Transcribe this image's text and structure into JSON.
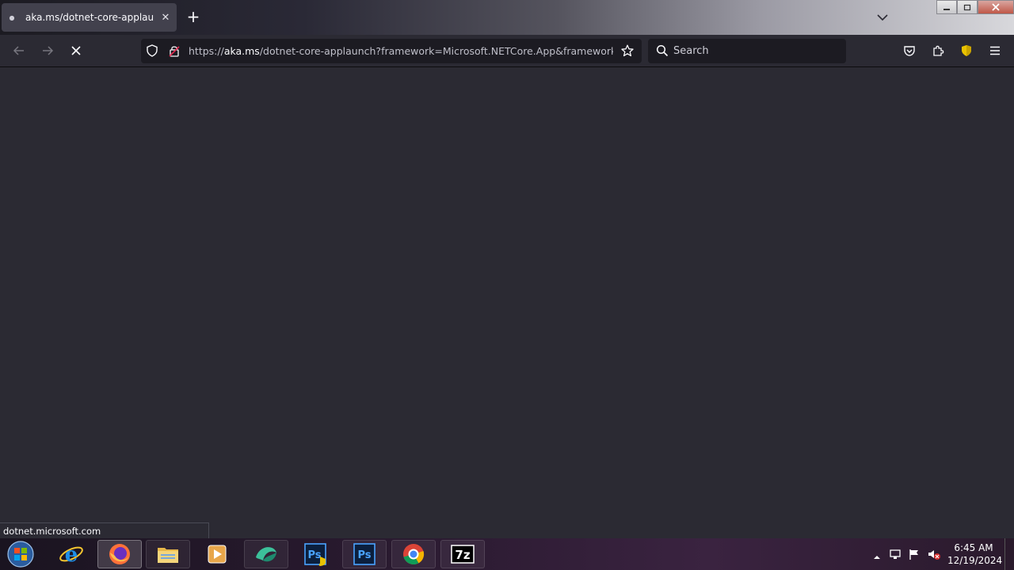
{
  "browser": {
    "tab": {
      "title": "aka.ms/dotnet-core-applaunch",
      "favicon": "bullet-icon",
      "close_glyph": "✕"
    },
    "new_tab_glyph": "+",
    "url": {
      "scheme": "https://",
      "host": "aka.ms",
      "rest": "/dotnet-core-applaunch?framework=Microsoft.NETCore.App&framework_"
    },
    "search": {
      "placeholder": "Search"
    },
    "status_text": "dotnet.microsoft.com",
    "colors": {
      "chrome": "#2b2a33",
      "field": "#1c1b22",
      "tab": "#42414d",
      "shield": "#e9c200"
    }
  },
  "taskbar": {
    "apps": [
      {
        "name": "internet-explorer"
      },
      {
        "name": "firefox"
      },
      {
        "name": "file-explorer"
      },
      {
        "name": "media-player"
      },
      {
        "name": "app-green"
      },
      {
        "name": "photoshop-elevated",
        "label": "Ps"
      },
      {
        "name": "photoshop",
        "label": "Ps"
      },
      {
        "name": "chrome"
      },
      {
        "name": "7zip",
        "label": "7z"
      }
    ],
    "clock": {
      "time": "6:45 AM",
      "date": "12/19/2024"
    }
  }
}
